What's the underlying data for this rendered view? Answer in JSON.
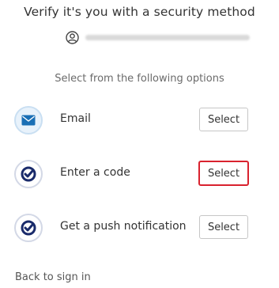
{
  "header": {
    "title": "Verify it's you with a security method"
  },
  "identity": {
    "icon": "user-circle-icon"
  },
  "instructions": "Select from the following options",
  "options": [
    {
      "label": "Email",
      "icon": "email-icon",
      "button_label": "Select"
    },
    {
      "label": "Enter a code",
      "icon": "okta-verify-icon",
      "button_label": "Select",
      "highlighted": true
    },
    {
      "label": "Get a push notification",
      "icon": "okta-verify-icon",
      "button_label": "Select"
    }
  ],
  "footer": {
    "back_link": "Back to sign in"
  },
  "colors": {
    "highlight_border": "#d9222e",
    "email_icon_blue": "#1a6fb5",
    "verify_icon_navy": "#1a2b6b"
  }
}
